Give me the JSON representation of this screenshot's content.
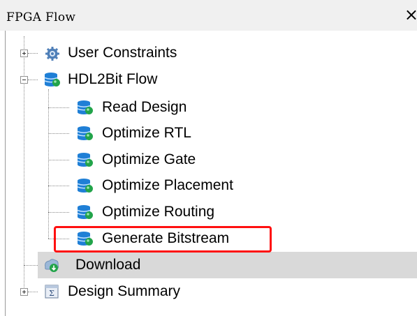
{
  "panel": {
    "title": "FPGA Flow",
    "close_glyph": "×"
  },
  "tree": {
    "items": [
      {
        "label": "User Constraints",
        "icon": "gear-icon",
        "expander": "plus",
        "level": 0
      },
      {
        "label": "HDL2Bit Flow",
        "icon": "database-icon",
        "expander": "minus",
        "level": 0
      },
      {
        "label": "Read Design",
        "icon": "database-icon",
        "level": 1
      },
      {
        "label": "Optimize RTL",
        "icon": "database-icon",
        "level": 1
      },
      {
        "label": "Optimize Gate",
        "icon": "database-icon",
        "level": 1
      },
      {
        "label": "Optimize Placement",
        "icon": "database-icon",
        "level": 1
      },
      {
        "label": "Optimize Routing",
        "icon": "database-icon",
        "level": 1
      },
      {
        "label": "Generate Bitstream",
        "icon": "database-icon",
        "level": 1,
        "highlighted": true
      },
      {
        "label": "Download",
        "icon": "download-icon",
        "level": 0,
        "selected": true
      },
      {
        "label": "Design Summary",
        "icon": "summary-icon",
        "expander": "plus",
        "level": 0
      }
    ]
  },
  "colors": {
    "highlight_border": "#ff1010",
    "selection_band": "#d9d9d9",
    "db_blue": "#1f7fd6",
    "db_green": "#22a44a"
  }
}
